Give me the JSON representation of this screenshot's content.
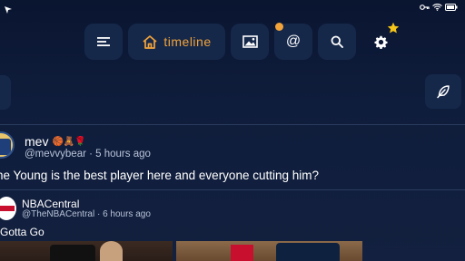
{
  "status_bar": {
    "left_icon": "location-arrow-icon",
    "right_icons": [
      "key-icon",
      "wifi-icon",
      "battery-icon"
    ]
  },
  "nav": {
    "menu_icon": "hamburger-menu-icon",
    "timeline_icon": "home-icon",
    "timeline_label": "timeline",
    "media_icon": "image-icon",
    "mentions_icon": "at-sign-icon",
    "mentions_label": "@",
    "search_icon": "search-icon",
    "settings_icon": "gear-icon",
    "settings_badge_icon": "star-icon",
    "accent_color": "#f2a33a"
  },
  "side": {
    "compose_icon": "feather-icon"
  },
  "post": {
    "display_name": "mev",
    "emojis": "🏀🧸🌹",
    "handle": "@mevvybear",
    "time": "5 hours ago",
    "meta": "@mevvybear · 5 hours ago",
    "text": "he Young is the best player here and everyone cutting him?"
  },
  "quote": {
    "display_name": "NBACentral",
    "handle": "@TheNBACentral",
    "time": "6 hours ago",
    "meta": "@TheNBACentral · 6 hours ago",
    "text": "Gotta Go"
  },
  "colors": {
    "background": "#0f1d3c",
    "button_bg": "#16284a",
    "accent": "#f2a33a",
    "muted_text": "#b8c3d8"
  }
}
